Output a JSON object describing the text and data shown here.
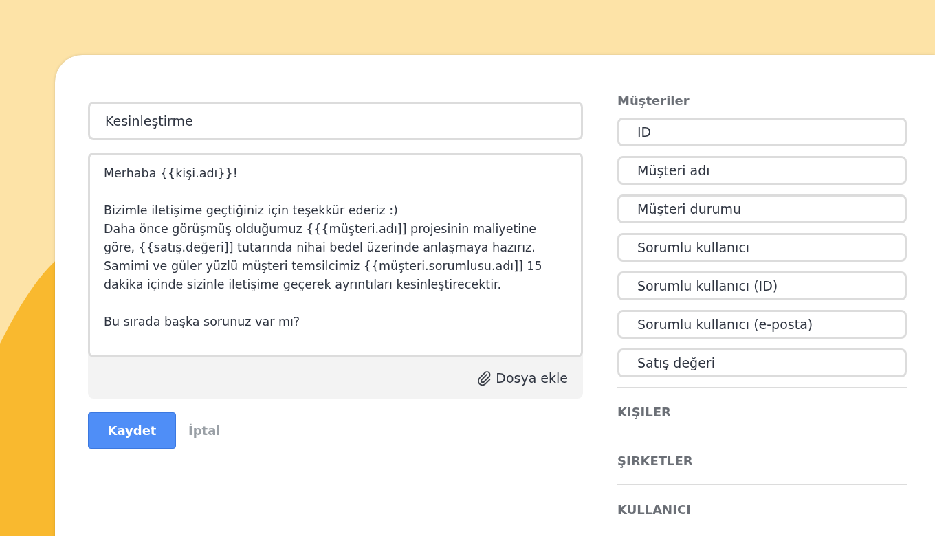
{
  "editor": {
    "subject": {
      "value": "Kesinleştirme"
    },
    "message": {
      "value": "Merhaba {{kişi.adı}}!\n\nBizimle iletişime geçtiğiniz için teşekkür ederiz :)\nDaha önce görüşmüş olduğumuz {{{müşteri.adı]] projesinin maliyetine göre, {{satış.değeri]] tutarında nihai bedel üzerinde anlaşmaya hazırız. Samimi ve güler yüzlü müşteri temsilcimiz {{müşteri.sorumlusu.adı]] 15 dakika içinde sizinle iletişime geçerek ayrıntıları kesinleştirecektir.\n\nBu sırada başka sorunuz var mı?"
    },
    "attach": "Dosya ekle",
    "buttons": {
      "save": "Kaydet",
      "cancel": "İptal"
    }
  },
  "fields_panel": {
    "title": "Müşteriler",
    "fields": [
      "ID",
      "Müşteri adı",
      "Müşteri durumu",
      "Sorumlu kullanıcı",
      "Sorumlu kullanıcı (ID)",
      "Sorumlu kullanıcı (e-posta)",
      "Satış değeri"
    ],
    "sections": [
      "KIŞILER",
      "ŞIRKETLER",
      "KULLANICI"
    ]
  }
}
